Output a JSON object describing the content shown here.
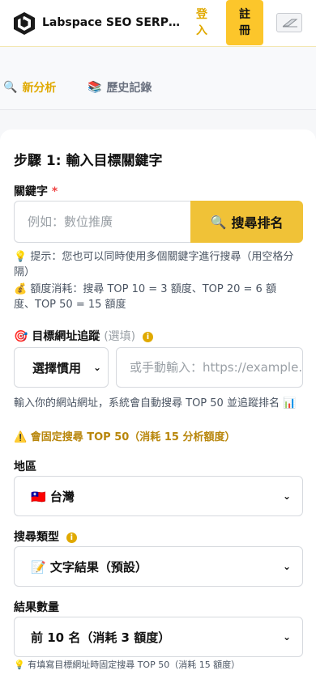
{
  "header": {
    "app_title": "Labspace SEO SERP ...",
    "login_label": "登\n入",
    "register_label": "註\n冊"
  },
  "tabs": [
    {
      "icon": "🔍",
      "label": "新分析"
    },
    {
      "icon": "📚",
      "label": "歷史記錄"
    }
  ],
  "form": {
    "step_title": "步驟 1: 輸入目標關鍵字",
    "keyword": {
      "label": "關鍵字",
      "required_mark": "*",
      "placeholder": "例如：數位推廣",
      "value": "",
      "search_button": "搜尋排名",
      "search_icon": "🔍"
    },
    "hint_tip": "💡 提示：您也可以同時使用多個關鍵字進行搜尋（用空格分隔）",
    "hint_cost": "💰 額度消耗：搜尋 TOP 10 = 3 額度、TOP 20 = 6 額度、TOP 50 = 15 額度",
    "target_url": {
      "icon": "🎯",
      "label": "目標網址追蹤",
      "optional": "(選填)",
      "select_value": "選擇慣用",
      "placeholder": "或手動輸入：https://example.com",
      "value": ""
    },
    "target_hint": "輸入你的網站網址，系統會自動搜尋 TOP 50 並追蹤排名 📊",
    "target_warning": "⚠️ 會固定搜尋 TOP 50（消耗 15 分析額度）",
    "region": {
      "label": "地區",
      "value": "🇹🇼 台灣"
    },
    "search_type": {
      "label": "搜尋類型",
      "value": "📝 文字結果（預設）"
    },
    "result_count": {
      "label": "結果數量",
      "value": "前 10 名（消耗 3 額度）"
    },
    "bottom_hint": "💡 有填寫目標網址時固定搜尋 TOP 50（消耗 15 額度）"
  },
  "colors": {
    "accent": "#fcc62b",
    "accent_text": "#e0a900",
    "warning_text": "#b8860b"
  }
}
